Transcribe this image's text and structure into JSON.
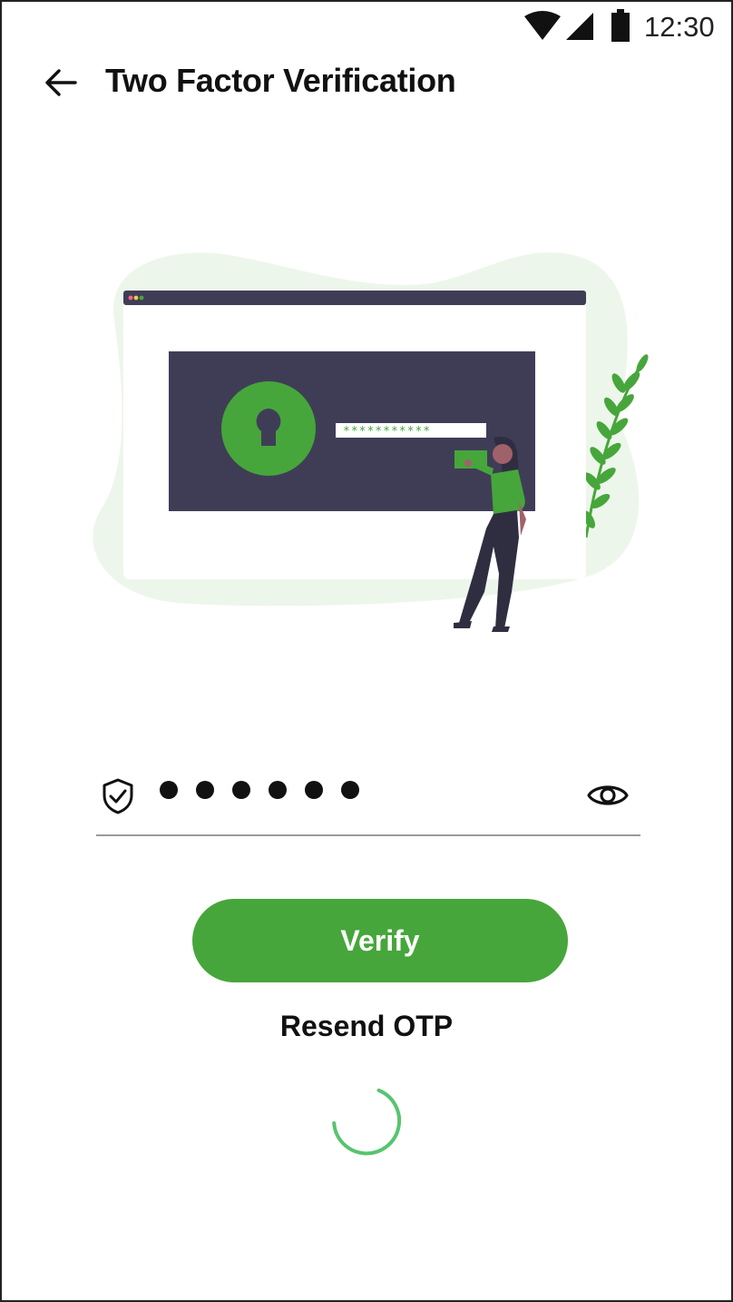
{
  "status_bar": {
    "time": "12:30",
    "icons": [
      "wifi-icon",
      "signal-icon",
      "battery-icon"
    ]
  },
  "app_bar": {
    "title": "Two Factor Verification",
    "back_icon": "arrow-left-icon"
  },
  "illustration": {
    "screen_password_text": "***********"
  },
  "otp": {
    "length": 6,
    "shield_icon": "shield-check-icon",
    "toggle_icon": "eye-icon"
  },
  "actions": {
    "verify_label": "Verify",
    "resend_label": "Resend OTP"
  },
  "loading": {
    "indicator_icon": "spinner-icon"
  },
  "colors": {
    "accent": "#46a63b",
    "spinner": "#57c46f",
    "illustration_dark": "#3f3d56",
    "blob": "#eef5ec"
  }
}
